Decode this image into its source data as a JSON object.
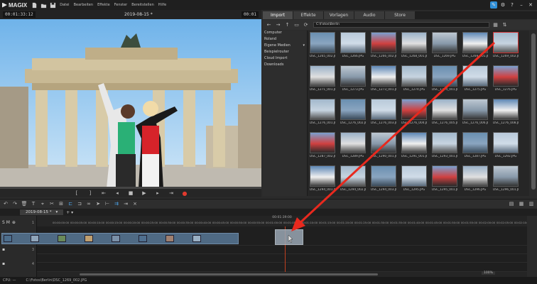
{
  "app": {
    "logo": "MAGIX",
    "menu": [
      "Datei",
      "Bearbeiten",
      "Effekte",
      "Fenster",
      "Bereitstellen",
      "Hilfe"
    ]
  },
  "preview": {
    "timecode_left": "00:01:33:12",
    "title": "2019-08-15 *",
    "timecode_right": "00:01"
  },
  "mediapool": {
    "tabs": [
      "Import",
      "Effekte",
      "Vorlagen",
      "Audio",
      "Store"
    ],
    "active_tab": "Import",
    "path": "C:\\Fotos\\Berlin",
    "tree": [
      {
        "label": "Computer",
        "arrow": ""
      },
      {
        "label": "Roland",
        "arrow": ""
      },
      {
        "label": "Eigene Medien",
        "arrow": "▾"
      },
      {
        "label": "Beispielrouter",
        "arrow": ""
      },
      {
        "label": "Cloud Import",
        "arrow": ""
      },
      {
        "label": "Downloads",
        "arrow": ""
      }
    ],
    "rows": [
      [
        "DSC_1265_002.JPG",
        "DSC_1266.JPG",
        "DSC_1266_002.JPG",
        "DSC_1268_001.JPG",
        "DSC_1269.JPG",
        "DSC_1269_001.JPG",
        "DSC_1269_002.JPG"
      ],
      [
        "DSC_1271_001.JPG",
        "DSC_1273.JPG",
        "DSC_1273_001.JPG",
        "DSC_1274.JPG",
        "DSC_1274_001.JPG",
        "DSC_1275.JPG",
        "DSC_1276.JPG"
      ],
      [
        "DSC_1276_001.JPG",
        "DSC_1276_002.JPG",
        "DSC_1276_003.JPG",
        "DSC_1276_004.JPG",
        "DSC_1276_005.JPG",
        "DSC_1276_006.JPG",
        "DSC_1276_008.JPG"
      ],
      [
        "DSC_1287_002.JPG",
        "DSC_1289.JPG",
        "DSC_1290_001.JPG",
        "DSC_1291_001.JPG",
        "DSC_1293_001.JPG",
        "DSC_1287.JPG",
        "DSC_1292.JPG"
      ],
      [
        "DSC_1294_001.JPG",
        "DSC_1294_002.JPG",
        "DSC_1294_003.JPG",
        "DSC_1295.JPG",
        "DSC_1295_001.JPG",
        "DSC_1296.JPG",
        "DSC_1296_001.JPG"
      ]
    ]
  },
  "timeline": {
    "tab_label": "2019-08-15 *",
    "ruler_top": "00:01:39:00",
    "ruler_ticks": [
      "00:00:00:00",
      "00:00:05:00",
      "00:00:10:00",
      "00:00:15:00",
      "00:00:20:00",
      "00:00:25:00",
      "00:00:30:00",
      "00:00:35:00",
      "00:00:40:00",
      "00:00:45:00",
      "00:00:50:00",
      "00:00:55:00",
      "00:01:00:00",
      "00:01:05:00",
      "00:01:10:00",
      "00:01:15:00",
      "00:01:20:00",
      "00:01:25:00",
      "00:01:30:00",
      "00:01:35:00",
      "00:01:40:00",
      "00:01:45:00",
      "00:01:50:00",
      "00:01:55:00",
      "00:02:00:00",
      "00:02:05:00",
      "00:02:10:00"
    ],
    "track_header": "S M",
    "track_numbers": [
      "1",
      "2",
      "3",
      "4"
    ],
    "zoom_label": "100%"
  },
  "status": {
    "cpu": "CPU: —",
    "file": "C:\\Fotos\\Berlin\\DSC_1269_002.JPG"
  },
  "colors": {
    "accent": "#2f8fd8",
    "arrow": "#e8291e",
    "clip": "#4f6a84"
  }
}
